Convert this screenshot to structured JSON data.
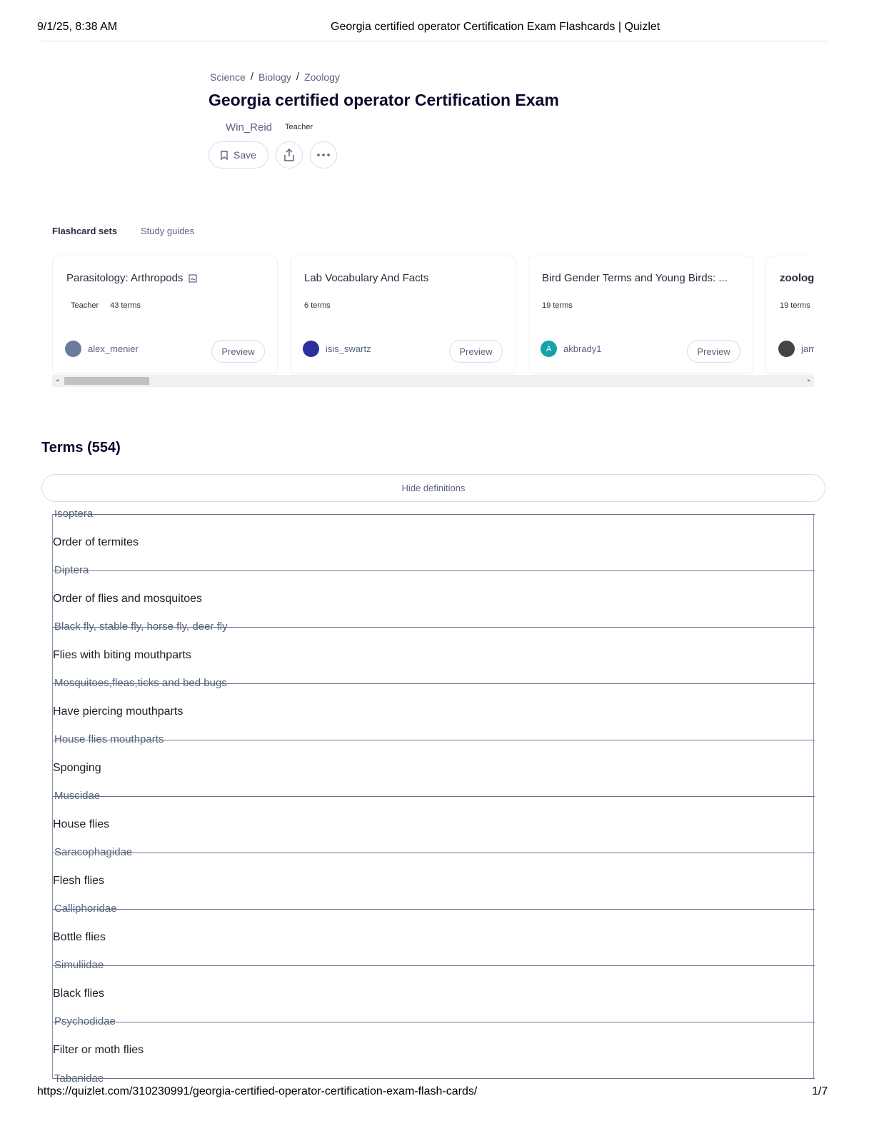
{
  "print": {
    "date": "9/1/25, 8:38 AM",
    "title": "Georgia certified operator Certification Exam Flashcards | Quizlet",
    "url": "https://quizlet.com/310230991/georgia-certified-operator-certification-exam-flash-cards/",
    "page": "1/7"
  },
  "breadcrumb": [
    "Science",
    "Biology",
    "Zoology"
  ],
  "set": {
    "title": "Georgia certified operator Certification Exam",
    "author": "Win_Reid",
    "author_role": "Teacher",
    "save_label": "Save"
  },
  "tabs": [
    "Flashcard sets",
    "Study guides"
  ],
  "cards": [
    {
      "title": "Parasitology: Arthropods",
      "role": "Teacher",
      "terms": "43 terms",
      "user": "alex_menier",
      "preview": "Preview",
      "avatar_color": "#6b7a99"
    },
    {
      "title": "Lab Vocabulary And Facts",
      "role": "",
      "terms": "6 terms",
      "user": "isis_swartz",
      "preview": "Preview",
      "avatar_color": "#2d2f9c"
    },
    {
      "title": "Bird Gender Terms and Young Birds: ...",
      "role": "",
      "terms": "19 terms",
      "user": "akbrady1",
      "preview": "Preview",
      "avatar_color": "#13a3a8",
      "avatar_letter": "A"
    },
    {
      "title": "zoolog",
      "role": "",
      "terms": "19 terms",
      "user": "jam",
      "preview": "Preview",
      "avatar_color": "#444444"
    }
  ],
  "terms_heading": "Terms (554)",
  "hide_definitions": "Hide definitions",
  "terms": [
    {
      "term": "Isoptera",
      "definition": "Order of termites"
    },
    {
      "term": "Diptera",
      "definition": "Order of flies and mosquitoes"
    },
    {
      "term": "Black fly, stable fly, horse fly, deer fly",
      "definition": "Flies with biting mouthparts"
    },
    {
      "term": "Mosquitoes,fleas,ticks and bed bugs",
      "definition": "Have piercing mouthparts"
    },
    {
      "term": "House flies mouthparts",
      "definition": "Sponging"
    },
    {
      "term": "Muscidae",
      "definition": "House flies"
    },
    {
      "term": "Saracophagidae",
      "definition": "Flesh flies"
    },
    {
      "term": "Calliphoridae",
      "definition": "Bottle flies"
    },
    {
      "term": "Simuliidae",
      "definition": "Black flies"
    },
    {
      "term": "Psychodidae",
      "definition": "Filter or moth flies"
    },
    {
      "term": "Tabanidae",
      "definition": ""
    }
  ]
}
